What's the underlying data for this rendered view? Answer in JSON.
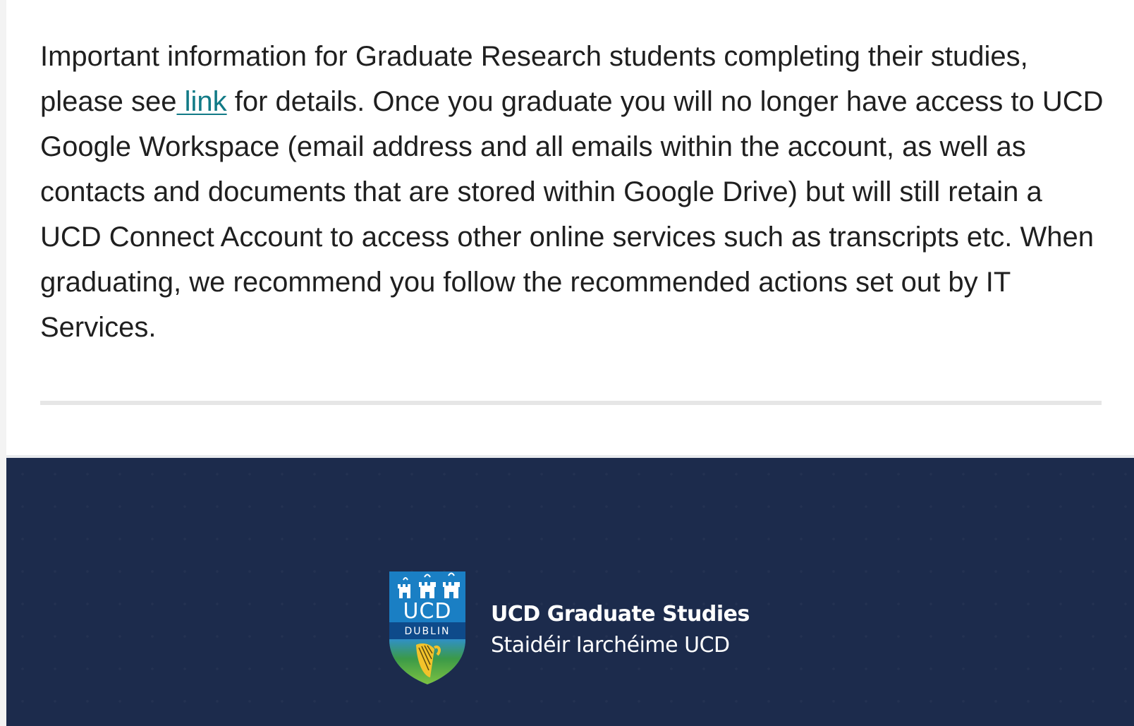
{
  "notice": {
    "text_before_link": "Important information for Graduate Research students completing their studies, please see",
    "link_label": " link",
    "text_after_link": " for details. Once you graduate you will no longer have access to UCD Google Workspace (email address and all emails within the account, as well as contacts and documents that are stored within Google Drive) but will still retain a UCD Connect Account to access other online services such as transcripts etc. When graduating, we recommend you follow the recommended actions set out by IT Services."
  },
  "footer": {
    "logo": {
      "crest_top": "UCD",
      "crest_bottom": "DUBLIN",
      "line1": "UCD Graduate Studies",
      "line2": "Staidéir Iarchéime UCD"
    },
    "background_color": "#1c2b4c"
  },
  "colors": {
    "link": "#117a86",
    "text": "#1f1f1f",
    "crest_blue": "#1a7fc4",
    "crest_dark_blue": "#0e4a8a",
    "crest_green": "#4aa53c",
    "harp_gold": "#f3c32b"
  },
  "icons": [
    "ucd-crest-icon",
    "castle-icon",
    "harp-icon"
  ]
}
